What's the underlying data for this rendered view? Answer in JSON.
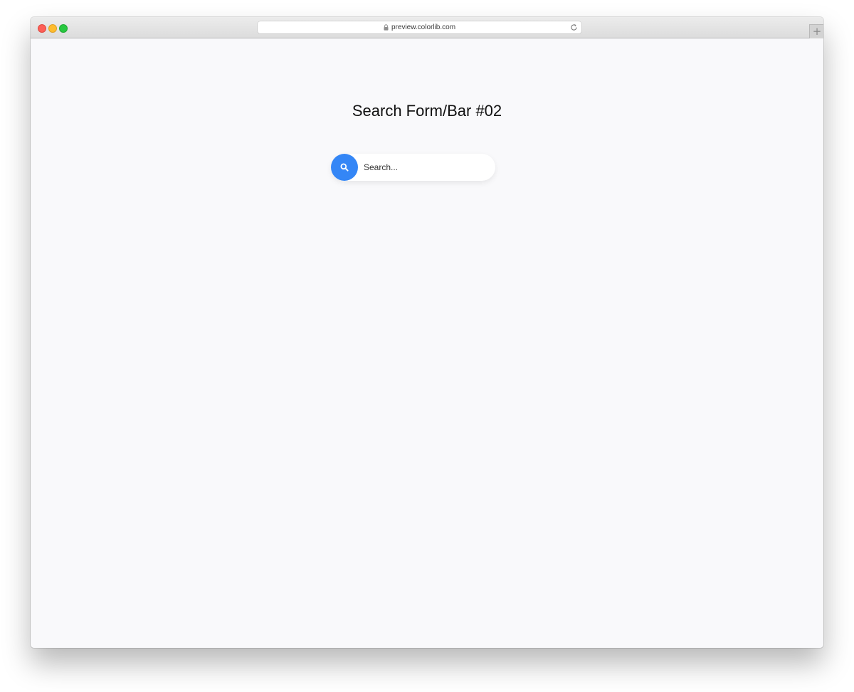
{
  "browser": {
    "url": "preview.colorlib.com",
    "new_tab_label": "+"
  },
  "page": {
    "title": "Search Form/Bar #02"
  },
  "search": {
    "placeholder": "Search...",
    "value": "",
    "button_icon": "search-icon",
    "button_color": "#3486f6"
  }
}
